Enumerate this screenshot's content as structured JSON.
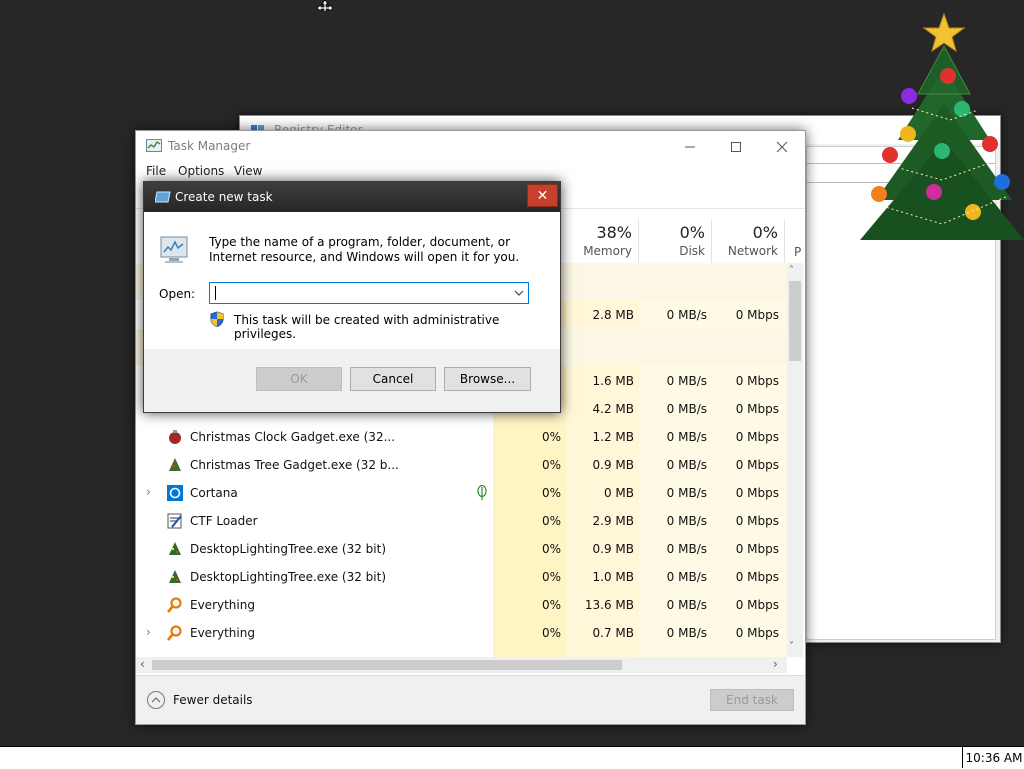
{
  "registry_editor": {
    "title": "Registry Editor"
  },
  "task_manager": {
    "title": "Task Manager",
    "menu": [
      "File",
      "Options",
      "View"
    ],
    "columns": {
      "memory": {
        "pct": "38%",
        "label": "Memory"
      },
      "disk": {
        "pct": "0%",
        "label": "Disk"
      },
      "network": {
        "pct": "0%",
        "label": "Network"
      },
      "power": {
        "label": "P"
      }
    },
    "rows_upper": [
      {
        "memory": "2.8 MB",
        "disk": "0 MB/s",
        "network": "0 Mbps"
      },
      {
        "memory": "1.6 MB",
        "disk": "0 MB/s",
        "network": "0 Mbps"
      },
      {
        "memory": "4.2 MB",
        "disk": "0 MB/s",
        "network": "0 Mbps"
      }
    ],
    "processes": [
      {
        "name": "Christmas Clock Gadget.exe (32...",
        "cpu": "0%",
        "memory": "1.2 MB",
        "disk": "0 MB/s",
        "network": "0 Mbps",
        "icon": "ornament-icon"
      },
      {
        "name": "Christmas Tree Gadget.exe (32 b...",
        "cpu": "0%",
        "memory": "0.9 MB",
        "disk": "0 MB/s",
        "network": "0 Mbps",
        "icon": "tree-icon"
      },
      {
        "name": "Cortana",
        "cpu": "0%",
        "memory": "0 MB",
        "disk": "0 MB/s",
        "network": "0 Mbps",
        "icon": "cortana-icon"
      },
      {
        "name": "CTF Loader",
        "cpu": "0%",
        "memory": "2.9 MB",
        "disk": "0 MB/s",
        "network": "0 Mbps",
        "icon": "ctf-icon"
      },
      {
        "name": "DesktopLightingTree.exe (32 bit)",
        "cpu": "0%",
        "memory": "0.9 MB",
        "disk": "0 MB/s",
        "network": "0 Mbps",
        "icon": "lighting-tree-icon"
      },
      {
        "name": "DesktopLightingTree.exe (32 bit)",
        "cpu": "0%",
        "memory": "1.0 MB",
        "disk": "0 MB/s",
        "network": "0 Mbps",
        "icon": "lighting-tree-icon"
      },
      {
        "name": "Everything",
        "cpu": "0%",
        "memory": "13.6 MB",
        "disk": "0 MB/s",
        "network": "0 Mbps",
        "icon": "magnifier-icon"
      },
      {
        "name": "Everything",
        "cpu": "0%",
        "memory": "0.7 MB",
        "disk": "0 MB/s",
        "network": "0 Mbps",
        "icon": "magnifier-icon"
      }
    ],
    "fewer_details": "Fewer details",
    "end_task": "End task"
  },
  "dialog": {
    "title": "Create new task",
    "description": "Type the name of a program, folder, document, or Internet resource, and Windows will open it for you.",
    "open_label": "Open:",
    "open_value": "",
    "admin_note": "This task will be created with administrative privileges.",
    "ok": "OK",
    "cancel": "Cancel",
    "browse": "Browse..."
  },
  "taskbar": {
    "clock": "10:36 AM"
  },
  "colors": {
    "accent": "#0078d7",
    "close_red": "#c6402e",
    "cpu_band": "#fff4c4",
    "mem_band": "#fff9e0"
  }
}
